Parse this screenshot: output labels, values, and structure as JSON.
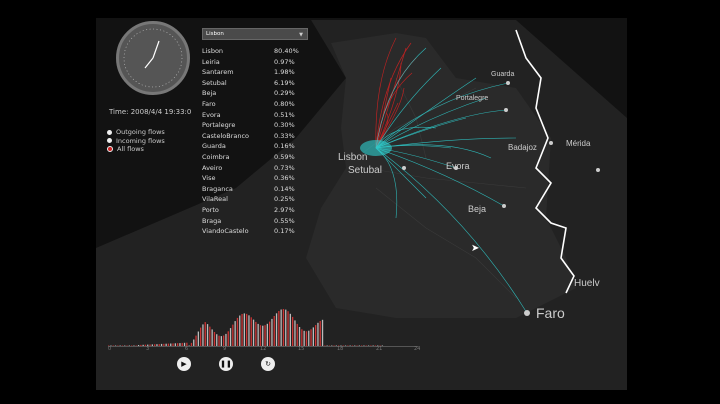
{
  "time_label": "Time: 2008/4/4 19:33:0",
  "legend": [
    {
      "label": "Outgoing flows",
      "color": "#eeeeee"
    },
    {
      "label": "Incoming flows",
      "color": "#eeeeee"
    },
    {
      "label": "All flows",
      "color": "#cc2222"
    }
  ],
  "selected_city": "Lisbon",
  "city_stats": [
    {
      "city": "Lisbon",
      "pct": "80.40%"
    },
    {
      "city": "Leiria",
      "pct": "0.97%"
    },
    {
      "city": "Santarem",
      "pct": "1.98%"
    },
    {
      "city": "Setubal",
      "pct": "6.19%"
    },
    {
      "city": "Beja",
      "pct": "0.29%"
    },
    {
      "city": "Faro",
      "pct": "0.80%"
    },
    {
      "city": "Evora",
      "pct": "0.51%"
    },
    {
      "city": "Portalegre",
      "pct": "0.30%"
    },
    {
      "city": "CasteloBranco",
      "pct": "0.33%"
    },
    {
      "city": "Guarda",
      "pct": "0.16%"
    },
    {
      "city": "Coimbra",
      "pct": "0.59%"
    },
    {
      "city": "Aveiro",
      "pct": "0.73%"
    },
    {
      "city": "Vise",
      "pct": "0.36%"
    },
    {
      "city": "Braganca",
      "pct": "0.14%"
    },
    {
      "city": "VilaReal",
      "pct": "0.25%"
    },
    {
      "city": "Porto",
      "pct": "2.97%"
    },
    {
      "city": "Braga",
      "pct": "0.55%"
    },
    {
      "city": "ViandoCastelo",
      "pct": "0.17%"
    }
  ],
  "map_labels": {
    "lisbon": "Lisbon",
    "setubal": "Setubal",
    "evora": "Evora",
    "beja": "Beja",
    "faro": "Faro",
    "badajoz": "Badajoz",
    "merida": "Mérida",
    "huelva": "Huelv",
    "portalegre": "Portalegre",
    "guarda": "Guarda"
  },
  "axis_ticks": [
    "0",
    "3",
    "6",
    "9",
    "12",
    "15",
    "18",
    "21",
    "24"
  ],
  "colors": {
    "outgoing": "#2fd0d0",
    "incoming": "#cc2222",
    "border": "#ffffff"
  }
}
